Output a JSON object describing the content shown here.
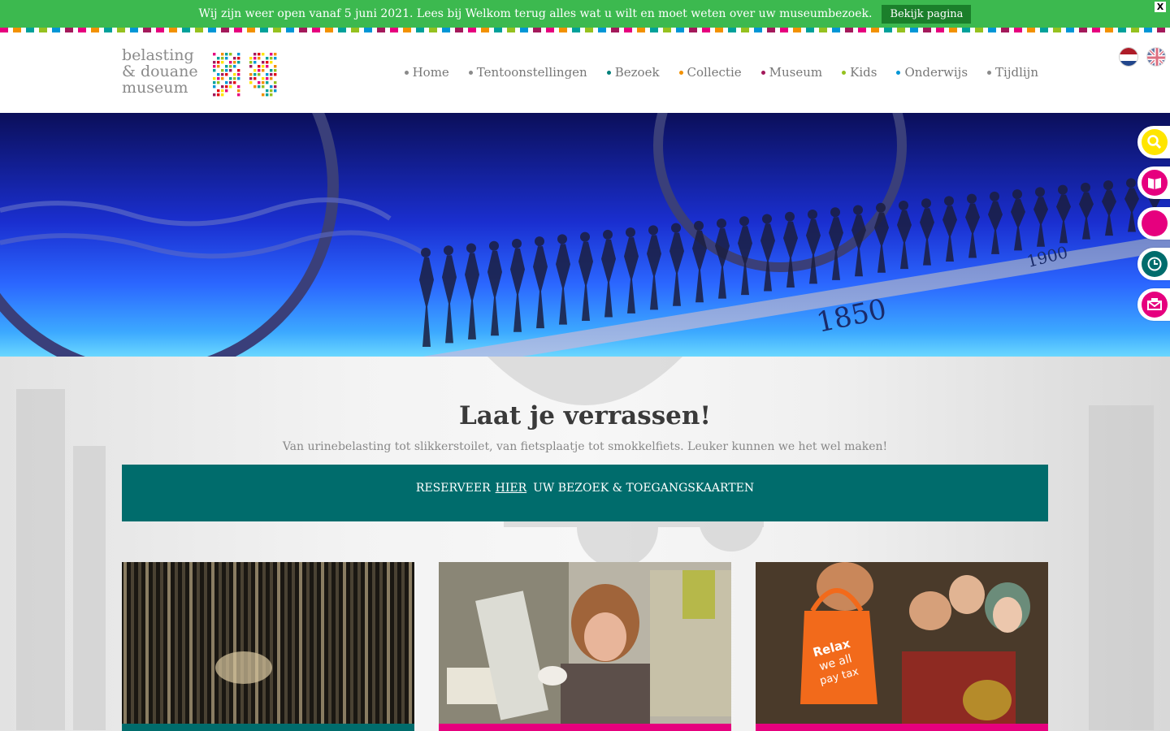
{
  "notice": {
    "text": "Wij zijn weer open vanaf 5 juni 2021. Lees bij Welkom terug alles wat u wilt en moet weten over uw museumbezoek.",
    "button": "Bekijk pagina",
    "close": "X"
  },
  "logo": {
    "line1": "belasting",
    "line2": "& douane",
    "line3": "museum"
  },
  "nav": [
    {
      "label": "Home",
      "color": "#8a8a8a"
    },
    {
      "label": "Tentoonstellingen",
      "color": "#8a8a8a"
    },
    {
      "label": "Bezoek",
      "color": "#00807a"
    },
    {
      "label": "Collectie",
      "color": "#f29100"
    },
    {
      "label": "Museum",
      "color": "#a3195b"
    },
    {
      "label": "Kids",
      "color": "#95c11f"
    },
    {
      "label": "Onderwijs",
      "color": "#0096d6"
    },
    {
      "label": "Tijdlijn",
      "color": "#8a8a8a"
    }
  ],
  "languages": [
    "nl-flag-icon",
    "en-flag-icon"
  ],
  "hero": {
    "years": [
      "1850",
      "1900"
    ]
  },
  "side_buttons": [
    {
      "icon": "search-icon",
      "color": "#ffe500"
    },
    {
      "icon": "book-icon",
      "color": "#e6007e"
    },
    {
      "icon": "circle-icon",
      "color": "#e6007e"
    },
    {
      "icon": "clock-icon",
      "color": "#006c6c"
    },
    {
      "icon": "mail-icon",
      "color": "#e6007e"
    }
  ],
  "main": {
    "headline": "Laat je verrassen!",
    "tagline": "Van urinebelasting tot slikkerstoilet, van fietsplaatje tot smokkelfiets. Leuker kunnen we het wel maken!",
    "reserve": {
      "prefix": "RESERVEER",
      "link": "HIER",
      "suffix": "UW BEZOEK & TOEGANGSKAARTEN"
    }
  },
  "cards": [
    {
      "bar_color": "#006c6c",
      "image": "dark-installation-image"
    },
    {
      "bar_color": "#e6007e",
      "image": "girl-writing-image"
    },
    {
      "bar_color": "#e6007e",
      "image": "painting-relax-bag-image",
      "bag_lines": [
        "Relax",
        "we all",
        "pay tax"
      ]
    }
  ]
}
